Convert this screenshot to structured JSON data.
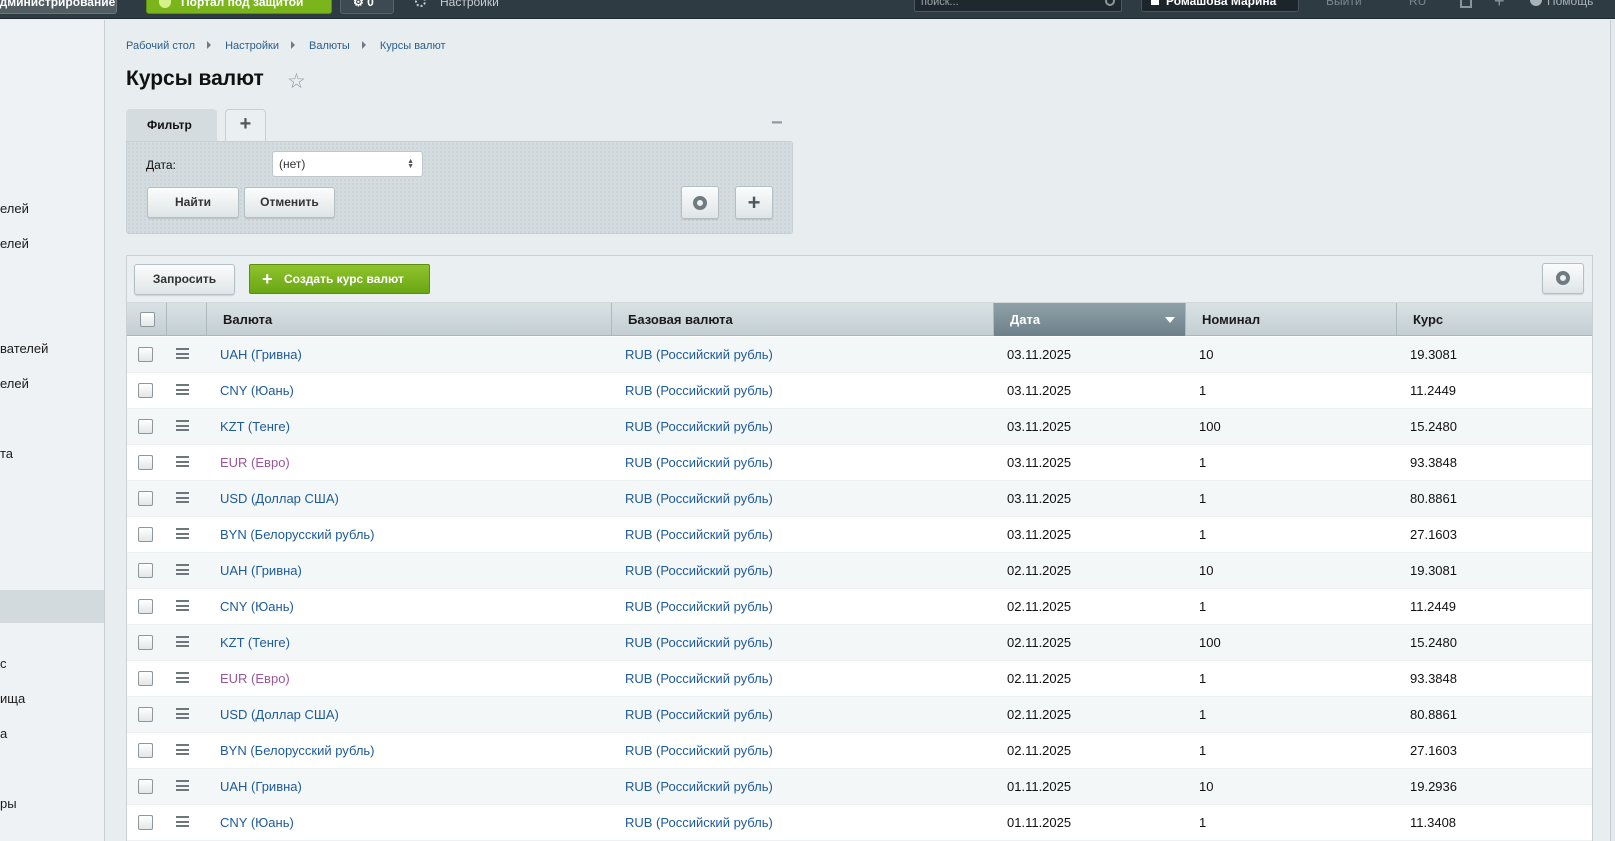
{
  "topbar": {
    "admin_label": "Администрирование",
    "portal_label": "Портал под защитой",
    "gear_count": "0",
    "settings_label": "Настройки",
    "search_placeholder": "поиск...",
    "user_label": "Ромашова Марина",
    "exit_label": "Выйти",
    "lang": "RU",
    "help_label": "Помощь"
  },
  "sidebar": {
    "items": [
      "елей",
      "елей",
      "вателей",
      "елей",
      "та",
      "с",
      "ища",
      "а",
      "ры"
    ]
  },
  "breadcrumb": [
    "Рабочий стол",
    "Настройки",
    "Валюты",
    "Курсы валют"
  ],
  "page": {
    "title": "Курсы валют"
  },
  "filter": {
    "tab_label": "Фильтр",
    "add_tab": "+",
    "date_label": "Дата:",
    "date_value": "(нет)",
    "find_label": "Найти",
    "cancel_label": "Отменить"
  },
  "toolbar": {
    "request_label": "Запросить",
    "create_label": "Создать курс валют"
  },
  "grid": {
    "columns": [
      "Валюта",
      "Базовая валюта",
      "Дата",
      "Номинал",
      "Курс"
    ],
    "sorted_column": "Дата",
    "rows": [
      {
        "currency": "UAH (Гривна)",
        "base": "RUB (Российский рубль)",
        "date": "03.11.2025",
        "nominal": "10",
        "rate": "19.3081",
        "visited": false
      },
      {
        "currency": "CNY (Юань)",
        "base": "RUB (Российский рубль)",
        "date": "03.11.2025",
        "nominal": "1",
        "rate": "11.2449",
        "visited": false
      },
      {
        "currency": "KZT (Тенге)",
        "base": "RUB (Российский рубль)",
        "date": "03.11.2025",
        "nominal": "100",
        "rate": "15.2480",
        "visited": false
      },
      {
        "currency": "EUR (Евро)",
        "base": "RUB (Российский рубль)",
        "date": "03.11.2025",
        "nominal": "1",
        "rate": "93.3848",
        "visited": true
      },
      {
        "currency": "USD (Доллар США)",
        "base": "RUB (Российский рубль)",
        "date": "03.11.2025",
        "nominal": "1",
        "rate": "80.8861",
        "visited": false
      },
      {
        "currency": "BYN (Белорусский рубль)",
        "base": "RUB (Российский рубль)",
        "date": "03.11.2025",
        "nominal": "1",
        "rate": "27.1603",
        "visited": false
      },
      {
        "currency": "UAH (Гривна)",
        "base": "RUB (Российский рубль)",
        "date": "02.11.2025",
        "nominal": "10",
        "rate": "19.3081",
        "visited": false
      },
      {
        "currency": "CNY (Юань)",
        "base": "RUB (Российский рубль)",
        "date": "02.11.2025",
        "nominal": "1",
        "rate": "11.2449",
        "visited": false
      },
      {
        "currency": "KZT (Тенге)",
        "base": "RUB (Российский рубль)",
        "date": "02.11.2025",
        "nominal": "100",
        "rate": "15.2480",
        "visited": false
      },
      {
        "currency": "EUR (Евро)",
        "base": "RUB (Российский рубль)",
        "date": "02.11.2025",
        "nominal": "1",
        "rate": "93.3848",
        "visited": true
      },
      {
        "currency": "USD (Доллар США)",
        "base": "RUB (Российский рубль)",
        "date": "02.11.2025",
        "nominal": "1",
        "rate": "80.8861",
        "visited": false
      },
      {
        "currency": "BYN (Белорусский рубль)",
        "base": "RUB (Российский рубль)",
        "date": "02.11.2025",
        "nominal": "1",
        "rate": "27.1603",
        "visited": false
      },
      {
        "currency": "UAH (Гривна)",
        "base": "RUB (Российский рубль)",
        "date": "01.11.2025",
        "nominal": "10",
        "rate": "19.2936",
        "visited": false
      },
      {
        "currency": "CNY (Юань)",
        "base": "RUB (Российский рубль)",
        "date": "01.11.2025",
        "nominal": "1",
        "rate": "11.3408",
        "visited": false
      }
    ]
  },
  "colors": {
    "link": "#1d5a9b",
    "visited_link": "#9a569a",
    "accent_green": "#7ab61b",
    "topbar_bg": "#2f3b43"
  },
  "icons": [
    "shield-icon",
    "gear-icon",
    "search-icon",
    "star-icon",
    "plus-icon",
    "minus-icon",
    "row-menu-icon",
    "help-icon",
    "sort-desc-icon"
  ]
}
